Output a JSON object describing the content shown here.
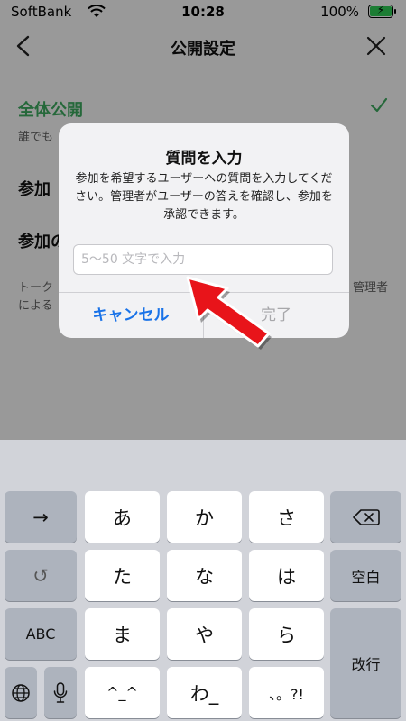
{
  "status_bar": {
    "carrier": "SoftBank",
    "time": "10:28",
    "battery": "100%",
    "battery_level": 1.0,
    "battery_color": "#2fd158"
  },
  "nav": {
    "title": "公開設定",
    "back_icon": "chevron-left-icon",
    "close_icon": "close-icon"
  },
  "options": [
    {
      "title": "全体公開",
      "subtitle": "誰でも",
      "selected": true
    },
    {
      "title": "参加"
    },
    {
      "title": "参加の"
    }
  ],
  "footer": {
    "left": "トーク\nによる",
    "right": "管理者"
  },
  "dialog": {
    "title": "質問を入力",
    "message": "参加を希望するユーザーへの質問を入力してください。管理者がユーザーの答えを確認し、参加を承認できます。",
    "input_value": "",
    "input_placeholder": "5〜50 文字で入力",
    "cancel_label": "キャンセル",
    "done_label": "完了"
  },
  "annotation": {
    "color": "#e8141a",
    "icon": "red-arrow-icon"
  },
  "keyboard": {
    "arrow_key": "→",
    "undo_key": "↺",
    "abc_key": "ABC",
    "globe_key": "globe-icon",
    "mic_key": "mic-icon",
    "delete_key": "delete-icon",
    "space_key": "空白",
    "return_key": "改行",
    "keys": [
      "あ",
      "か",
      "さ",
      "た",
      "な",
      "は",
      "ま",
      "や",
      "ら",
      "^_^",
      "わ_",
      "、。?!"
    ]
  },
  "colors": {
    "accent_green": "#3fae62",
    "link_blue": "#1a73e8"
  }
}
